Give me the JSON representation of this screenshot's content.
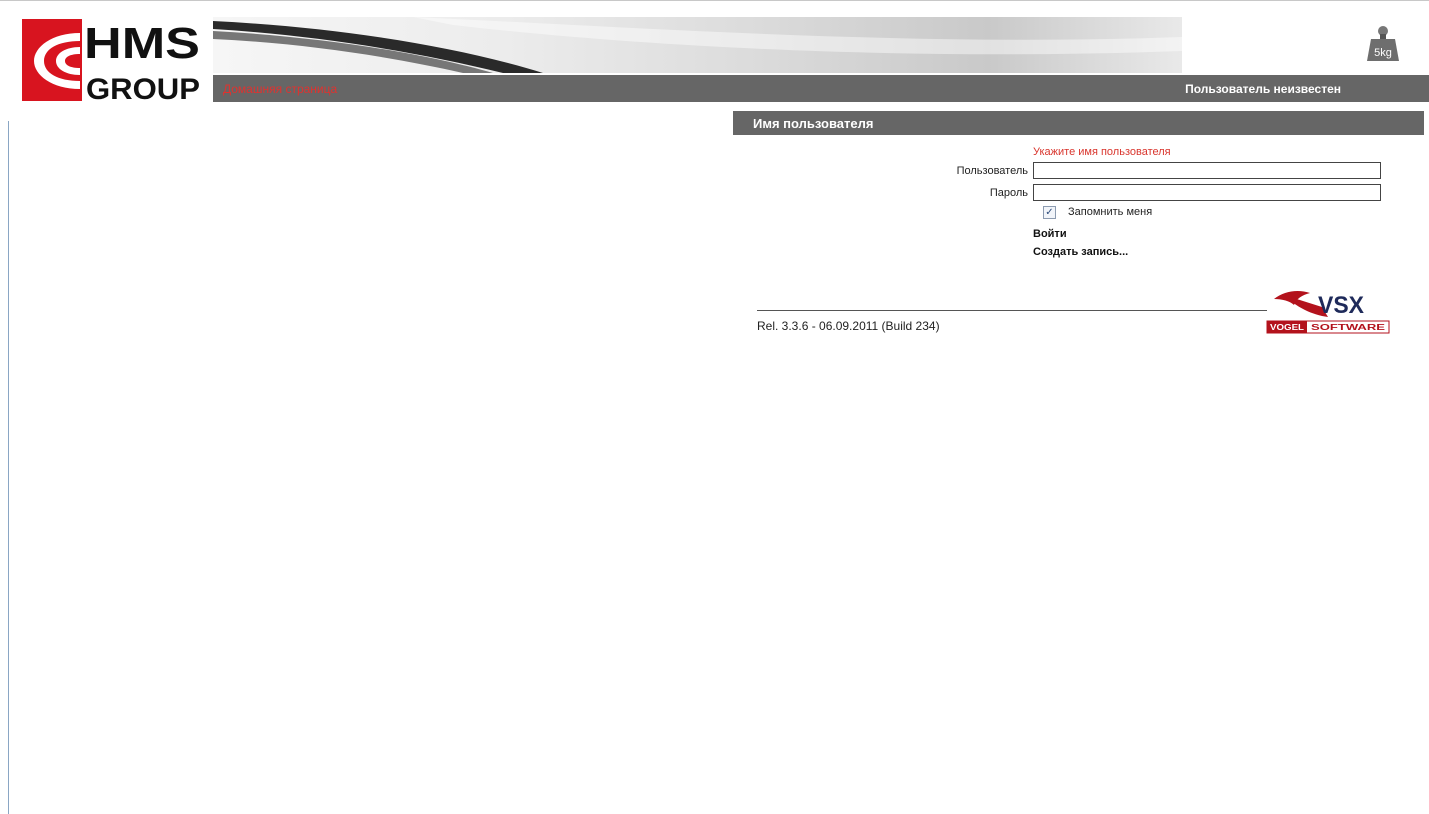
{
  "header": {
    "logo_line1": "HMS",
    "logo_line2": "GROUP",
    "home_link": "Домашняя страница",
    "user_status": "Пользователь неизвестен",
    "weight_icon_text": "5kg"
  },
  "login": {
    "title": "Имя пользователя",
    "error": "Укажите имя пользователя",
    "user_label": "Пользователь",
    "user_value": "",
    "password_label": "Пароль",
    "password_value": "",
    "remember_label": "Запомнить меня",
    "remember_checked": true,
    "login_link": "Войти",
    "register_link": "Создать запись..."
  },
  "footer": {
    "release": "Rel. 3.3.6 - 06.09.2011 (Build 234)",
    "vendor_logo_text": "VSX",
    "vendor_name_1": "VOGEL",
    "vendor_name_2": "SOFTWARE"
  },
  "colors": {
    "bar": "#666666",
    "accent_red": "#e0322f",
    "logo_red": "#d8141f"
  },
  "icons": [
    "weight-icon",
    "checkbox-check-icon"
  ]
}
